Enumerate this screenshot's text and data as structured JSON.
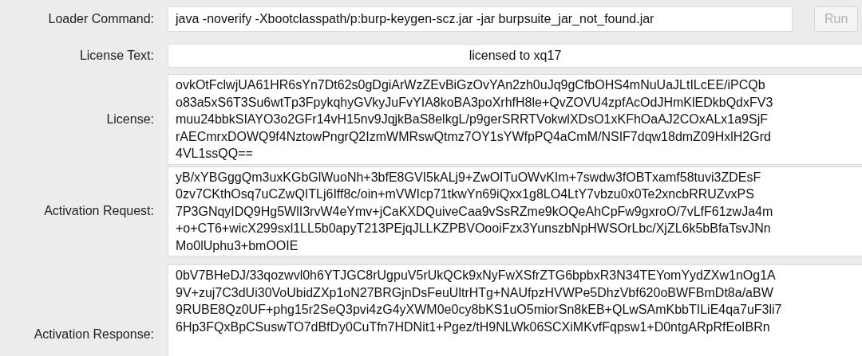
{
  "loader_command": {
    "label": "Loader Command:",
    "value": "java -noverify -Xbootclasspath/p:burp-keygen-scz.jar -jar burpsuite_jar_not_found.jar"
  },
  "run_button": {
    "label": "Run",
    "disabled": true
  },
  "license_text": {
    "label": "License Text:",
    "value": "licensed to xq17"
  },
  "areas": [
    {
      "label": "License:",
      "lines": [
        "ovkOtFclwjUA61HR6sYn7Dt62s0gDgiArWzZEvBiGzOvYAn2zh0uJq9gCfbOHS4mNuUaJLtILcEE/iPCQb",
        "o83a5xS6T3Su6wtTp3FpykqhyGVkyJuFvYIA8koBA3poXrhfH8le+QvZOVU4zpfAcOdJHmKlEDkbQdxFV3",
        "muu24bbkSIAYO3o2GFr14vH15nv9JqjkBaS8elkgL/p9gerSRRTVokwlXDsO1xKFhOaAJ2COxALx1a9SjF",
        "rAECmrxDOWQ9f4NztowPngrQ2IzmWMRswQtmz7OY1sYWfpPQ4aCmM/NSIF7dqw18dmZ09HxlH2Grd",
        "4VL1ssQQ=="
      ]
    },
    {
      "label": "Activation Request:",
      "lines": [
        "yB/xYBGggQm3uxKGbGlWuoNh+3bfE8GVI5kALj9+ZwOITuOWvKIm+7swdw3fOBTxamf58tuvi3ZDEsF",
        "0zv7CKthOsq7uCZwQITLj6Iff8c/oin+mVWIcp71tkwYn69iQxx1g8LO4LtY7vbzu0x0Te2xncbRRUZvxPS",
        "7P3GNqyIDQ9Hg5WlI3rvW4eYmv+jCaKXDQuiveCaa9vSsRZme9kOQeAhCpFw9gxroO/7vLfF61zwJa4m",
        "+o+CT6+wicX299sxl1LL5b0apyT213PEjqJLLKZPBVOooiFzx3YunszbNpHWSOrLbc/XjZL6k5bBfaTsvJNn",
        "Mo0lUphu3+bmOOIE"
      ]
    },
    {
      "label": "Activation Response:",
      "lines": [
        "0bV7BHeDJ/33qozwvl0h6YTJGC8rUgpuV5rUkQCk9xNyFwXSfrZTG6bpbxR3N34TEYomYydZXw1nOg1A",
        "9V+zuj7C3dUi30VoUbidZXp1oN27BRGjnDsFeuUltrHTg+NAUfpzHVWPe5DhzVbf620oBWFBmDt8a/aBW",
        "9RUBE8Qz0UF+phg15r2SeQ3pvi4zG4yXWM0e0cy8bKS1uO5miorSn8kEB+QLwSAmKbbTILiE4qa7uF3li7",
        "6Hp3FQxBpCSuswTO7dBfDy0CuTfn7HDNit1+Pgez/tH9NLWk06SCXiMKvfFqpsw1+D0ntgARpRfEoIBRn"
      ]
    }
  ]
}
